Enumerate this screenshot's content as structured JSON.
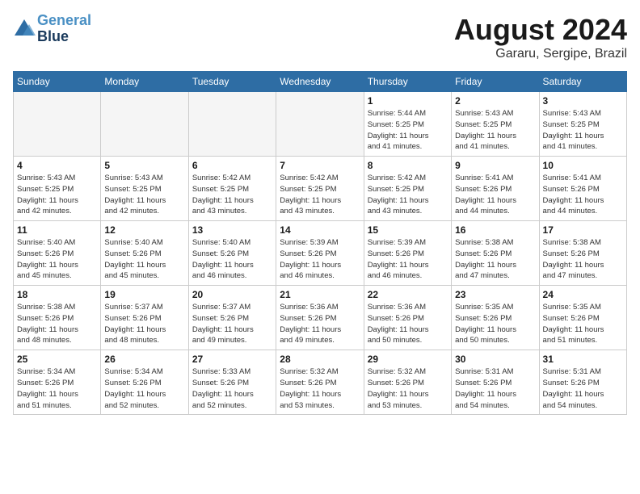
{
  "header": {
    "logo_line1": "General",
    "logo_line2": "Blue",
    "month": "August 2024",
    "location": "Gararu, Sergipe, Brazil"
  },
  "days_of_week": [
    "Sunday",
    "Monday",
    "Tuesday",
    "Wednesday",
    "Thursday",
    "Friday",
    "Saturday"
  ],
  "weeks": [
    [
      {
        "day": "",
        "info": ""
      },
      {
        "day": "",
        "info": ""
      },
      {
        "day": "",
        "info": ""
      },
      {
        "day": "",
        "info": ""
      },
      {
        "day": "1",
        "info": "Sunrise: 5:44 AM\nSunset: 5:25 PM\nDaylight: 11 hours\nand 41 minutes."
      },
      {
        "day": "2",
        "info": "Sunrise: 5:43 AM\nSunset: 5:25 PM\nDaylight: 11 hours\nand 41 minutes."
      },
      {
        "day": "3",
        "info": "Sunrise: 5:43 AM\nSunset: 5:25 PM\nDaylight: 11 hours\nand 41 minutes."
      }
    ],
    [
      {
        "day": "4",
        "info": "Sunrise: 5:43 AM\nSunset: 5:25 PM\nDaylight: 11 hours\nand 42 minutes."
      },
      {
        "day": "5",
        "info": "Sunrise: 5:43 AM\nSunset: 5:25 PM\nDaylight: 11 hours\nand 42 minutes."
      },
      {
        "day": "6",
        "info": "Sunrise: 5:42 AM\nSunset: 5:25 PM\nDaylight: 11 hours\nand 43 minutes."
      },
      {
        "day": "7",
        "info": "Sunrise: 5:42 AM\nSunset: 5:25 PM\nDaylight: 11 hours\nand 43 minutes."
      },
      {
        "day": "8",
        "info": "Sunrise: 5:42 AM\nSunset: 5:25 PM\nDaylight: 11 hours\nand 43 minutes."
      },
      {
        "day": "9",
        "info": "Sunrise: 5:41 AM\nSunset: 5:26 PM\nDaylight: 11 hours\nand 44 minutes."
      },
      {
        "day": "10",
        "info": "Sunrise: 5:41 AM\nSunset: 5:26 PM\nDaylight: 11 hours\nand 44 minutes."
      }
    ],
    [
      {
        "day": "11",
        "info": "Sunrise: 5:40 AM\nSunset: 5:26 PM\nDaylight: 11 hours\nand 45 minutes."
      },
      {
        "day": "12",
        "info": "Sunrise: 5:40 AM\nSunset: 5:26 PM\nDaylight: 11 hours\nand 45 minutes."
      },
      {
        "day": "13",
        "info": "Sunrise: 5:40 AM\nSunset: 5:26 PM\nDaylight: 11 hours\nand 46 minutes."
      },
      {
        "day": "14",
        "info": "Sunrise: 5:39 AM\nSunset: 5:26 PM\nDaylight: 11 hours\nand 46 minutes."
      },
      {
        "day": "15",
        "info": "Sunrise: 5:39 AM\nSunset: 5:26 PM\nDaylight: 11 hours\nand 46 minutes."
      },
      {
        "day": "16",
        "info": "Sunrise: 5:38 AM\nSunset: 5:26 PM\nDaylight: 11 hours\nand 47 minutes."
      },
      {
        "day": "17",
        "info": "Sunrise: 5:38 AM\nSunset: 5:26 PM\nDaylight: 11 hours\nand 47 minutes."
      }
    ],
    [
      {
        "day": "18",
        "info": "Sunrise: 5:38 AM\nSunset: 5:26 PM\nDaylight: 11 hours\nand 48 minutes."
      },
      {
        "day": "19",
        "info": "Sunrise: 5:37 AM\nSunset: 5:26 PM\nDaylight: 11 hours\nand 48 minutes."
      },
      {
        "day": "20",
        "info": "Sunrise: 5:37 AM\nSunset: 5:26 PM\nDaylight: 11 hours\nand 49 minutes."
      },
      {
        "day": "21",
        "info": "Sunrise: 5:36 AM\nSunset: 5:26 PM\nDaylight: 11 hours\nand 49 minutes."
      },
      {
        "day": "22",
        "info": "Sunrise: 5:36 AM\nSunset: 5:26 PM\nDaylight: 11 hours\nand 50 minutes."
      },
      {
        "day": "23",
        "info": "Sunrise: 5:35 AM\nSunset: 5:26 PM\nDaylight: 11 hours\nand 50 minutes."
      },
      {
        "day": "24",
        "info": "Sunrise: 5:35 AM\nSunset: 5:26 PM\nDaylight: 11 hours\nand 51 minutes."
      }
    ],
    [
      {
        "day": "25",
        "info": "Sunrise: 5:34 AM\nSunset: 5:26 PM\nDaylight: 11 hours\nand 51 minutes."
      },
      {
        "day": "26",
        "info": "Sunrise: 5:34 AM\nSunset: 5:26 PM\nDaylight: 11 hours\nand 52 minutes."
      },
      {
        "day": "27",
        "info": "Sunrise: 5:33 AM\nSunset: 5:26 PM\nDaylight: 11 hours\nand 52 minutes."
      },
      {
        "day": "28",
        "info": "Sunrise: 5:32 AM\nSunset: 5:26 PM\nDaylight: 11 hours\nand 53 minutes."
      },
      {
        "day": "29",
        "info": "Sunrise: 5:32 AM\nSunset: 5:26 PM\nDaylight: 11 hours\nand 53 minutes."
      },
      {
        "day": "30",
        "info": "Sunrise: 5:31 AM\nSunset: 5:26 PM\nDaylight: 11 hours\nand 54 minutes."
      },
      {
        "day": "31",
        "info": "Sunrise: 5:31 AM\nSunset: 5:26 PM\nDaylight: 11 hours\nand 54 minutes."
      }
    ]
  ]
}
